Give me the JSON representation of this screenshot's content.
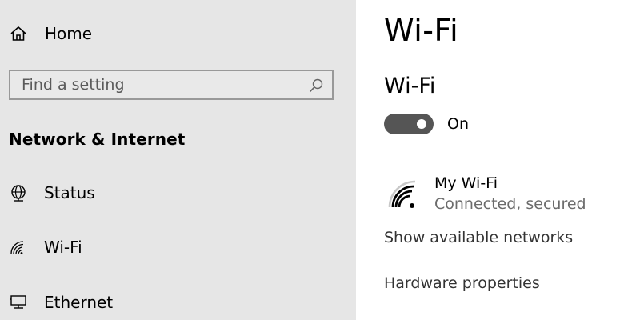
{
  "sidebar": {
    "home_label": "Home",
    "search": {
      "placeholder": "Find a setting",
      "value": ""
    },
    "section_title": "Network & Internet",
    "items": [
      {
        "label": "Status",
        "icon": "globe-icon"
      },
      {
        "label": "Wi-Fi",
        "icon": "wifi-icon"
      },
      {
        "label": "Ethernet",
        "icon": "ethernet-icon"
      }
    ]
  },
  "main": {
    "page_title": "Wi-Fi",
    "wifi_section_title": "Wi-Fi",
    "wifi_toggle": {
      "state": "On",
      "enabled": true
    },
    "network": {
      "name": "My Wi-Fi",
      "status": "Connected, secured",
      "icon": "wifi-signal-icon"
    },
    "links": {
      "show_available": "Show available networks",
      "hardware_properties": "Hardware properties"
    }
  },
  "colors": {
    "sidebar_bg": "#e6e6e6",
    "toggle_on": "#555555",
    "secondary_text": "#6b6b6b"
  }
}
